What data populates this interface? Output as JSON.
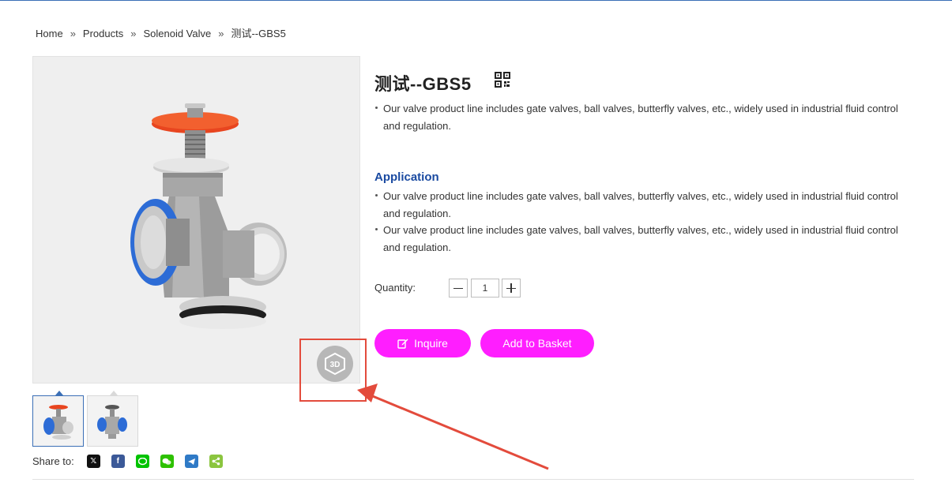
{
  "breadcrumb": {
    "items": [
      "Home",
      "Products",
      "Solenoid Valve",
      "测试--GBS5"
    ],
    "separator": "»"
  },
  "product": {
    "title": "测试--GBS5",
    "description": [
      "Our valve product line includes gate valves, ball valves, butterfly valves, etc., widely used in industrial fluid control and regulation."
    ],
    "application_heading": "Application",
    "application": [
      "Our valve product line includes gate valves, ball valves, butterfly valves, etc., widely used in industrial fluid control and regulation.",
      "Our valve product line includes gate valves, ball valves, butterfly valves, etc., widely used in industrial fluid control and regulation."
    ]
  },
  "quantity": {
    "label": "Quantity:",
    "value": "1"
  },
  "buttons": {
    "inquire": "Inquire",
    "basket": "Add to Basket",
    "view3d": "3D"
  },
  "share": {
    "label": "Share to:",
    "icons": [
      "x-icon",
      "facebook-icon",
      "line-icon",
      "wechat-icon",
      "telegram-icon",
      "share-icon"
    ]
  },
  "colors": {
    "accent_button": "#ff1eff",
    "heading_blue": "#1a4aa1",
    "annotation_red": "#e34b3c",
    "thumb_active_border": "#3b6fb6"
  }
}
